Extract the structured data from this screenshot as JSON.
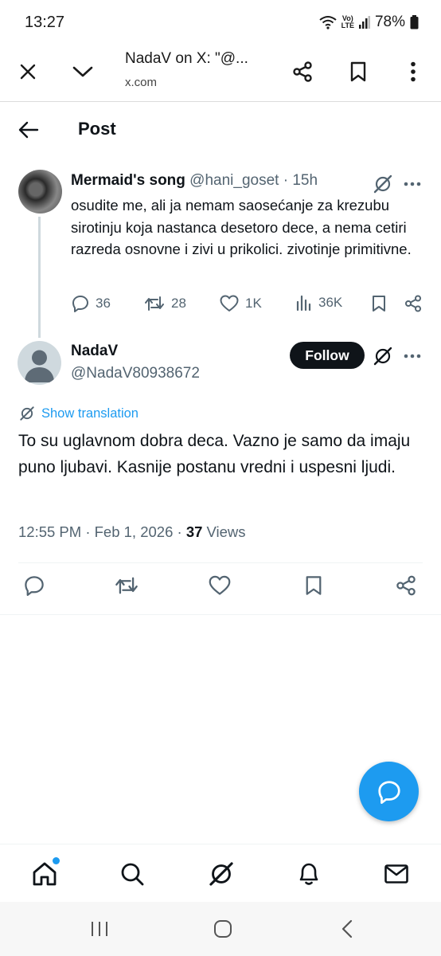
{
  "status_bar": {
    "time": "13:27",
    "network_top": "Vo)",
    "network_bottom": "LTE",
    "battery": "78%"
  },
  "browser": {
    "title": "NadaV on X: \"@...",
    "url": "x.com"
  },
  "post_header": {
    "title": "Post"
  },
  "parent_tweet": {
    "name": "Mermaid's song",
    "handle": "@hani_goset",
    "time": "· 15h",
    "text": "osudite me, ali ja nemam saosećanje za krezubu sirotinju koja nastanca desetoro dece, a nema cetiri razreda osnovne i zivi u prikolici. zivotinje primitivne.",
    "replies": "36",
    "reposts": "28",
    "likes": "1K",
    "views": "36K"
  },
  "main_tweet": {
    "name": "NadaV",
    "handle": "@NadaV80938672",
    "follow_label": "Follow",
    "translate_label": "Show translation",
    "text": "To su uglavnom dobra deca. Vazno je samo da imaju puno ljubavi. Kasnije postanu vredni i uspesni ljudi.",
    "timestamp": "12:55 PM · Feb 1, 2026 ·",
    "views_count": "37",
    "views_label": "Views"
  },
  "colors": {
    "accent": "#1d9bf0",
    "text": "#0f1419",
    "secondary": "#536471"
  },
  "icons": {
    "fab": "compose-reply-icon",
    "tabs": [
      "home-icon",
      "search-icon",
      "grok-icon",
      "notifications-icon",
      "messages-icon"
    ]
  }
}
